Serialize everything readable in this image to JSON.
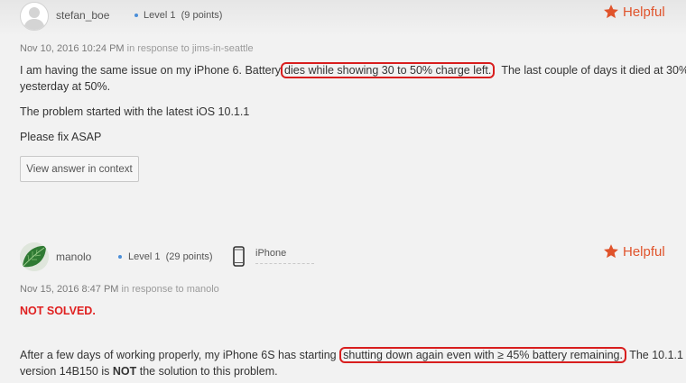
{
  "post1": {
    "username": "stefan_boe",
    "level": "Level 1",
    "points": "(9 points)",
    "helpful_label": "Helpful",
    "date": "Nov 10, 2016 10:24 PM",
    "in_response_prefix": "in response to",
    "in_response_to": "jims-in-seattle",
    "line1_pre": "I am having the same issue on my iPhone 6. Battery",
    "line1_highlight": "dies while showing 30 to 50% charge left.",
    "line1_post": "The last couple of days it died at 30%",
    "line2": "yesterday at 50%.",
    "para2": "The problem started with the latest iOS 10.1.1",
    "para3": "Please fix ASAP",
    "context_button": "View answer in context"
  },
  "post2": {
    "username": "manolo",
    "level": "Level 1",
    "points": "(29 points)",
    "device": "iPhone",
    "helpful_label": "Helpful",
    "date": "Nov 15, 2016 8:47 PM",
    "in_response_prefix": "in response to",
    "in_response_to": "manolo",
    "not_solved": "NOT SOLVED.",
    "line1_pre": "After a few days of working properly, my iPhone 6S has starting",
    "line1_highlight": "shutting down again even with ≥ 45% battery remaining.",
    "line1_post": "The 10.1.1",
    "line2_pre": "version 14B150 is",
    "line2_bold": "NOT",
    "line2_post": "the solution to this problem."
  },
  "colors": {
    "accent": "#e0532b",
    "highlight_border": "#d81e1e",
    "not_solved": "#e02020",
    "level_dot": "#4a8ed8"
  },
  "icons": {
    "helpful": "star-icon",
    "device": "iphone-icon",
    "avatar1": "default-user-avatar",
    "avatar2": "leaf-avatar"
  }
}
